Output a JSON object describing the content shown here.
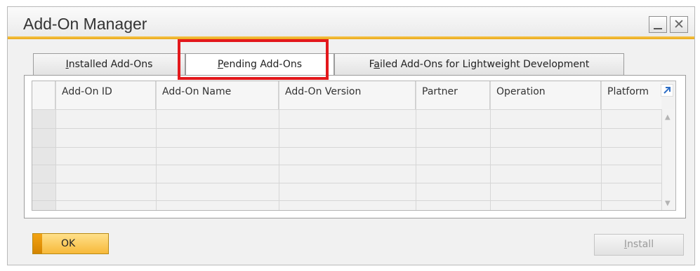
{
  "window": {
    "title": "Add-On Manager"
  },
  "tabs": [
    {
      "label_pre": "",
      "mnemonic": "I",
      "label_post": "nstalled Add-Ons"
    },
    {
      "label_pre": "",
      "mnemonic": "P",
      "label_post": "ending Add-Ons"
    },
    {
      "label_pre": "F",
      "mnemonic": "a",
      "label_post": "iled Add-Ons for Lightweight Development"
    }
  ],
  "active_tab": "Pending Add-Ons",
  "table": {
    "columns": [
      "Add-On ID",
      "Add-On Name",
      "Add-On Version",
      "Partner",
      "Operation",
      "Platform"
    ],
    "rows": []
  },
  "buttons": {
    "ok": "OK",
    "install_pre": "",
    "install_mnemonic": "I",
    "install_post": "nstall"
  },
  "colors": {
    "accent": "#f0b030",
    "highlight": "#e3181c"
  }
}
